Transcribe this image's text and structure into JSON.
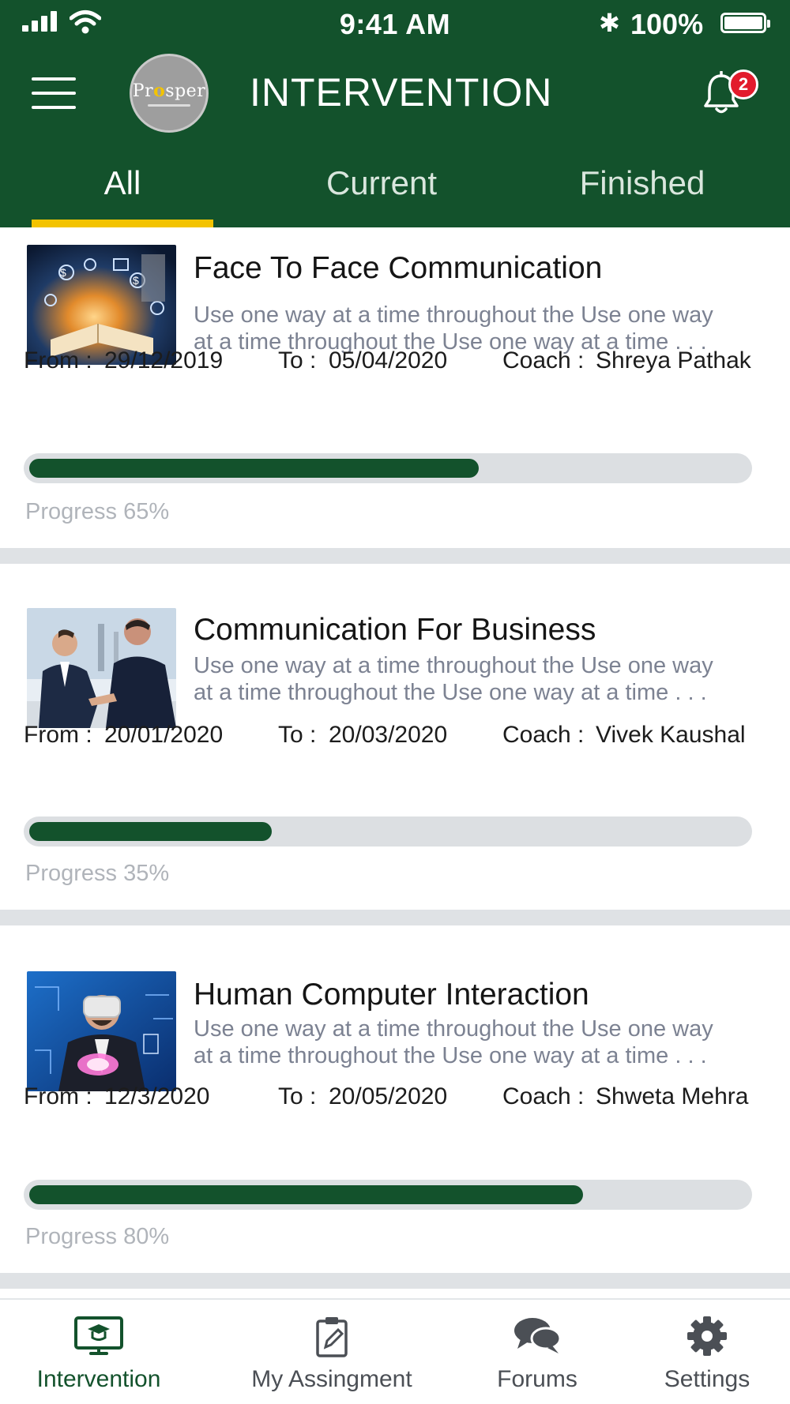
{
  "status_bar": {
    "time": "9:41 AM",
    "battery": "100%"
  },
  "header": {
    "logo_text": "Prosper",
    "title": "INTERVENTION",
    "notification_count": "2"
  },
  "tabs": [
    {
      "label": "All",
      "active": true
    },
    {
      "label": "Current",
      "active": false
    },
    {
      "label": "Finished",
      "active": false
    }
  ],
  "labels": {
    "from": "From :",
    "to": "To :",
    "coach": "Coach :"
  },
  "courses": [
    {
      "title": "Face To Face Communication",
      "desc_line1": "Use one way at a time throughout the Use one way",
      "desc_line2": "at a time throughout the Use one way at a time . . .",
      "from": "29/12/2019",
      "to": "05/04/2020",
      "coach": "Shreya Pathak",
      "progress": 0.65,
      "progress_label": "Progress 65%",
      "image": "digital-book-image"
    },
    {
      "title": "Communication For Business",
      "desc_line1": "Use one way at a time throughout the Use one way",
      "desc_line2": "at a time throughout the Use one way at a time . . .",
      "from": "20/01/2020",
      "to": "20/03/2020",
      "coach": "Vivek Kaushal",
      "progress": 0.35,
      "progress_label": "Progress 35%",
      "image": "business-handshake-image"
    },
    {
      "title": "Human Computer Interaction",
      "desc_line1": "Use one way at a time throughout the Use one way",
      "desc_line2": "at a time throughout the Use one way at a time . . .",
      "from": "12/3/2020",
      "to": "20/05/2020",
      "coach": "Shweta Mehra",
      "progress": 0.8,
      "progress_label": "Progress 80%",
      "image": "vr-headset-image"
    }
  ],
  "bottom_nav": [
    {
      "label": "Intervention",
      "icon": "classroom-monitor-icon",
      "active": true
    },
    {
      "label": "My Assingment",
      "icon": "clipboard-pen-icon",
      "active": false
    },
    {
      "label": "Forums",
      "icon": "chat-bubbles-icon",
      "active": false
    },
    {
      "label": "Settings",
      "icon": "gear-icon",
      "active": false
    }
  ],
  "colors": {
    "primary": "#13522c",
    "accent": "#f3c300",
    "badge": "#e21b2c",
    "track": "#dcdfe2"
  }
}
